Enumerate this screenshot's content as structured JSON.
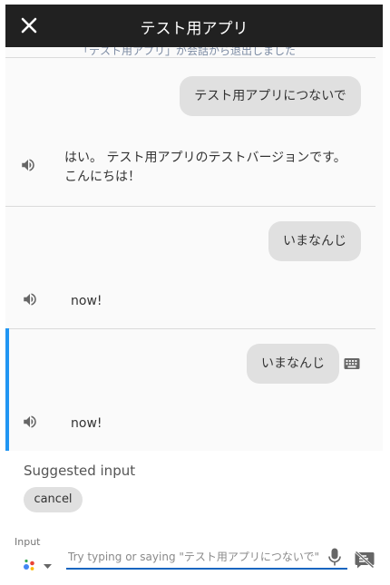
{
  "header": {
    "title": "テスト用アプリ",
    "close_icon": "close-icon"
  },
  "conversation": {
    "partial_system_message": "「テスト用アプリ」が会話から退出しました",
    "turns": [
      {
        "user": "テスト用アプリにつないで",
        "bot_lines": [
          "はい。 テスト用アプリのテストバージョンです。",
          "こんにちは！"
        ],
        "speaker_icon": "speaker-icon"
      },
      {
        "user": "いまなんじ",
        "bot_lines": [
          "now!"
        ],
        "speaker_icon": "speaker-icon"
      },
      {
        "user": "いまなんじ",
        "bot_lines": [
          "now!"
        ],
        "speaker_icon": "speaker-icon",
        "selected": true,
        "input_method_icon": "keyboard-icon"
      }
    ]
  },
  "suggestions": {
    "label": "Suggested input",
    "chips": [
      "cancel"
    ]
  },
  "input": {
    "label": "Input",
    "placeholder": "Try typing or saying \"テスト用アプリにつないで\"",
    "value": "",
    "assistant_icon": "google-assistant-icon",
    "dropdown_icon": "caret-down-icon",
    "mic_icon": "microphone-icon",
    "mute_icon": "speech-off-icon"
  },
  "colors": {
    "header_bg": "#212121",
    "accent": "#2196f3",
    "input_underline": "#1565c0",
    "bubble_bg": "#e0e0e0"
  }
}
